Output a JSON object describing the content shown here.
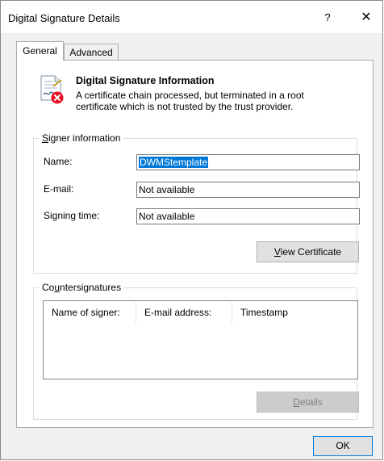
{
  "window": {
    "title": "Digital Signature Details",
    "help_glyph": "?",
    "close_glyph": "✕"
  },
  "tabs": [
    {
      "label": "General",
      "selected": true
    },
    {
      "label": "Advanced",
      "selected": false
    }
  ],
  "info": {
    "icon": "signed-document-error-icon",
    "title": "Digital Signature Information",
    "message": "A certificate chain processed, but terminated in a root certificate which is not trusted by the trust provider."
  },
  "signer": {
    "legend_key": "S",
    "legend_rest": "igner information",
    "fields": [
      {
        "label": "Name:",
        "value": "DWMStemplate"
      },
      {
        "label": "E-mail:",
        "value": "Not available"
      },
      {
        "label": "Signing time:",
        "value": "Not available"
      }
    ],
    "view_key": "V",
    "view_rest": "iew Certificate"
  },
  "countersignatures": {
    "legend_pre": "Co",
    "legend_key": "u",
    "legend_rest": "ntersignatures",
    "columns": [
      "Name of signer:",
      "E-mail address:",
      "Timestamp"
    ],
    "details_key": "D",
    "details_rest": "etails"
  },
  "footer": {
    "ok_label": "OK"
  },
  "colors": {
    "selection": "#0078d7",
    "ok_border": "#0078d7"
  }
}
